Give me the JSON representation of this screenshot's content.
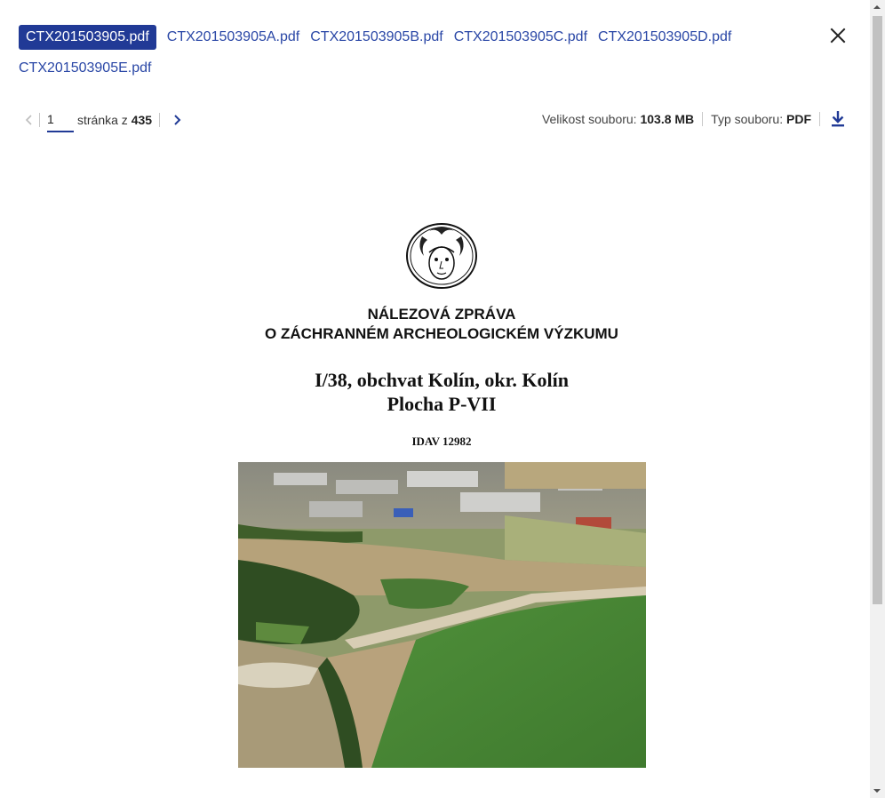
{
  "files": {
    "tabs": [
      {
        "label": "CTX201503905.pdf",
        "active": true
      },
      {
        "label": "CTX201503905A.pdf",
        "active": false
      },
      {
        "label": "CTX201503905B.pdf",
        "active": false
      },
      {
        "label": "CTX201503905C.pdf",
        "active": false
      },
      {
        "label": "CTX201503905D.pdf",
        "active": false
      },
      {
        "label": "CTX201503905E.pdf",
        "active": false
      }
    ]
  },
  "pager": {
    "current_page": "1",
    "page_label": "stránka z",
    "total_pages": "435"
  },
  "file_info": {
    "size_label": "Velikost souboru:",
    "size_value": "103.8 MB",
    "type_label": "Typ souboru:",
    "type_value": "PDF"
  },
  "document": {
    "title_line1": "NÁLEZOVÁ ZPRÁVA",
    "title_line2": "O ZÁCHRANNÉM ARCHEOLOGICKÉM VÝZKUMU",
    "subtitle_line1": "I/38, obchvat Kolín, okr. Kolín",
    "subtitle_line2": "Plocha P-VII",
    "idav": "IDAV 12982"
  },
  "icons": {
    "close": "close-icon",
    "prev": "chevron-left-icon",
    "next": "chevron-right-icon",
    "download": "download-icon"
  },
  "colors": {
    "accent": "#213a96",
    "link": "#2a47a6"
  }
}
